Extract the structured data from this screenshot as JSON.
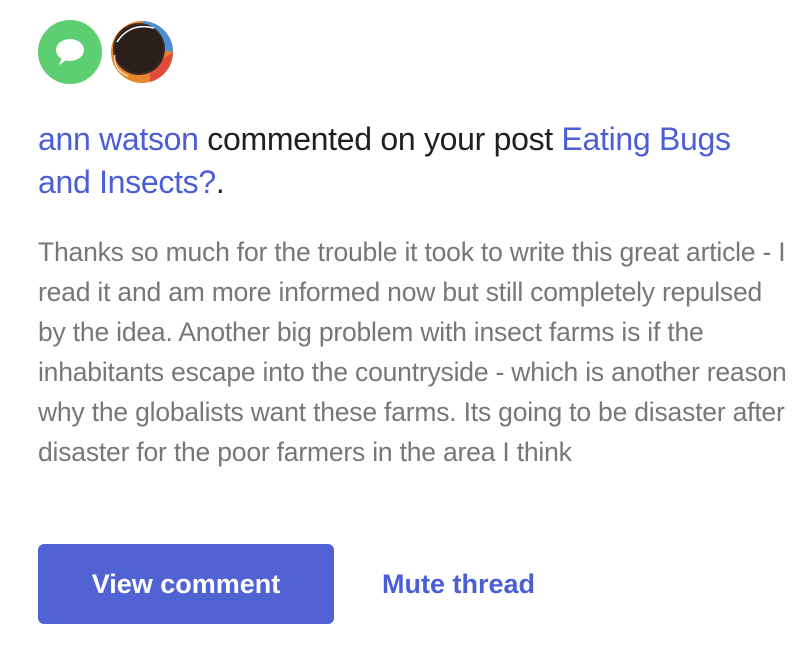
{
  "colors": {
    "accent": "#5162d3",
    "link": "#4b5ed6",
    "comment_icon_bg": "#5ccf73",
    "body_text": "#777777",
    "heading_text": "#1f1f1f"
  },
  "avatars": {
    "comment_icon": "speech-bubble-icon",
    "user_avatar": "user-avatar"
  },
  "notification": {
    "actor": "ann watson",
    "action": " commented on your post ",
    "post_title": "Eating Bugs and Insects?",
    "trailing": ".",
    "comment_text": "Thanks so much for the trouble it took to write this great article - I read it and am more informed now but still completely repulsed by the idea. Another big problem with insect farms is if the inhabitants escape into the countryside - which is another reason why the globalists want these farms. Its going to be disaster after disaster for the poor farmers in the area I think"
  },
  "actions": {
    "view_comment": "View comment",
    "mute_thread": "Mute thread"
  }
}
